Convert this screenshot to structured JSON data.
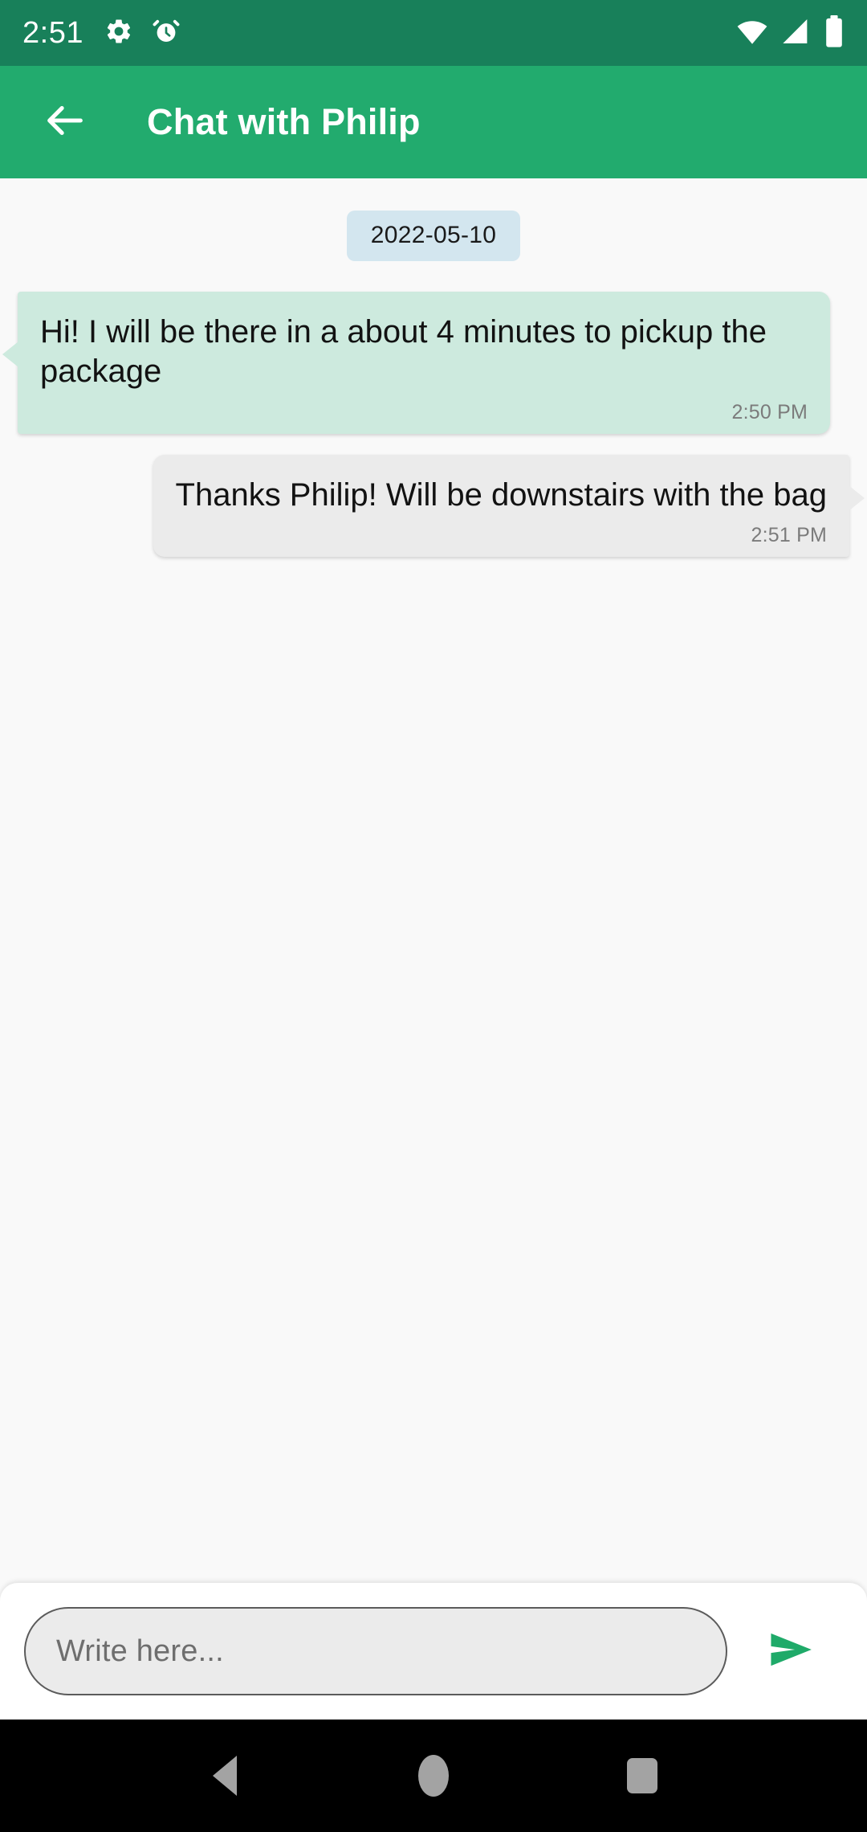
{
  "status_bar": {
    "time": "2:51",
    "left_icons": [
      "gear-icon",
      "alarm-clock-icon"
    ],
    "right_icons": [
      "wifi-icon",
      "cellular-signal-icon",
      "battery-icon"
    ],
    "background_color": "#18805a"
  },
  "header": {
    "back_icon": "arrow-left-icon",
    "title": "Chat with Philip",
    "background_color": "#22ab6e"
  },
  "chat": {
    "date_separator": "2022-05-10",
    "messages": [
      {
        "direction": "incoming",
        "text": "Hi! I will be there in a about 4 minutes to pickup the package",
        "time": "2:50 PM",
        "bubble_color": "#cdeade"
      },
      {
        "direction": "outgoing",
        "text": "Thanks Philip! Will be downstairs with the bag",
        "time": "2:51 PM",
        "bubble_color": "#ebebeb"
      }
    ],
    "background_color": "#f9f9f9"
  },
  "composer": {
    "placeholder": "Write here...",
    "value": "",
    "send_icon": "send-icon",
    "send_color": "#1faa69"
  },
  "nav_bar": {
    "buttons": [
      "back-triangle-icon",
      "home-circle-icon",
      "recents-square-icon"
    ],
    "background_color": "#000000",
    "icon_color": "#a3a3a3"
  }
}
